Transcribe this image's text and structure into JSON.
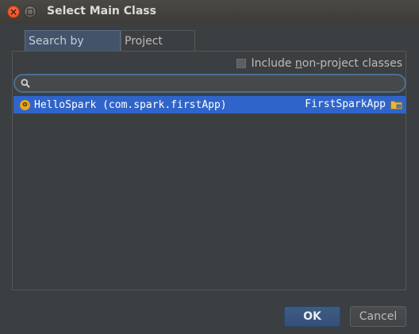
{
  "window": {
    "title": "Select Main Class"
  },
  "tabs": [
    {
      "label": "Search by Name",
      "active": true
    },
    {
      "label": "Project",
      "active": false
    }
  ],
  "options": {
    "include_non_project_label_pre": "Include ",
    "include_non_project_label_underline": "n",
    "include_non_project_label_post": "on-project classes",
    "include_non_project_checked": false
  },
  "search": {
    "value": "",
    "placeholder": ""
  },
  "results": [
    {
      "icon": "class-icon",
      "icon_letter": "o",
      "class_name": "HelloSpark (com.spark.firstApp)",
      "module": "FirstSparkApp",
      "module_icon": "module-folder-icon",
      "selected": true
    }
  ],
  "buttons": {
    "ok": "OK",
    "cancel": "Cancel"
  },
  "colors": {
    "selection": "#2f65ca",
    "background": "#3c3f41",
    "accent": "#4b6f93",
    "class_icon": "#e6a61c"
  }
}
